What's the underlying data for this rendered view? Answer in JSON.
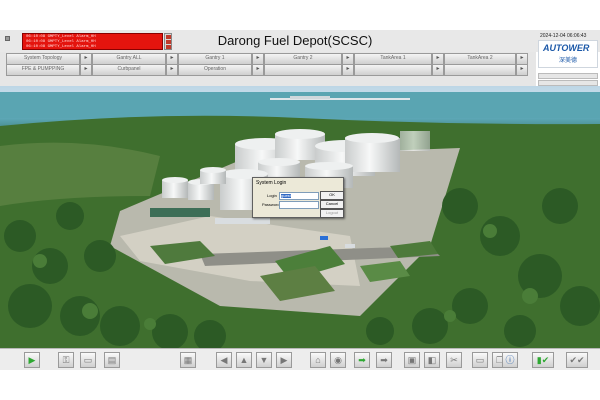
{
  "header": {
    "title": "Darong Fuel Depot(SCSC)",
    "datetime": "2024-12-04 06:06:43",
    "alarms": [
      "06:10:08  GMPTY_Level Alarm_HH",
      "06:10:08  GMPTY_Level Alarm_HH",
      "06:10:08  GMPTY_Level Alarm_HH"
    ],
    "logo": {
      "brand": "AUTOWER",
      "sub": "深美德"
    }
  },
  "nav": {
    "row1": [
      "System Topology",
      "Gantry ALL",
      "Gantry 1",
      "Gantry 2",
      "TankArea 1",
      "TankArea 2"
    ],
    "row2": [
      "FPE & PUMPPING",
      "Curbpanel",
      "Operation",
      "",
      "",
      ""
    ]
  },
  "dialog": {
    "title": "System Login",
    "login_label": "Login",
    "login_value": "guest",
    "password_label": "Password",
    "ok_label": "OK",
    "cancel_label": "Cancel",
    "extra_label": "Logout"
  },
  "colors": {
    "alarm_bg": "#e4140e",
    "logo_blue": "#1b58a8",
    "tank_white": "#f2f3f3",
    "toolbar_green": "#2ea832"
  },
  "toolbar": {
    "buttons": [
      "play-icon",
      "key-icon",
      "page-icon",
      "print-icon",
      "grid-icon",
      "arrow-left-icon",
      "arrow-up-icon",
      "arrow-down-icon",
      "arrow-right-icon",
      "house-icon",
      "tank-icon",
      "forward-green-icon",
      "forward-icon",
      "layers-icon",
      "tag-icon",
      "tools-icon",
      "screen-icon",
      "copy-icon",
      "info-icon",
      "chart-check-icon",
      "check-icon"
    ]
  }
}
